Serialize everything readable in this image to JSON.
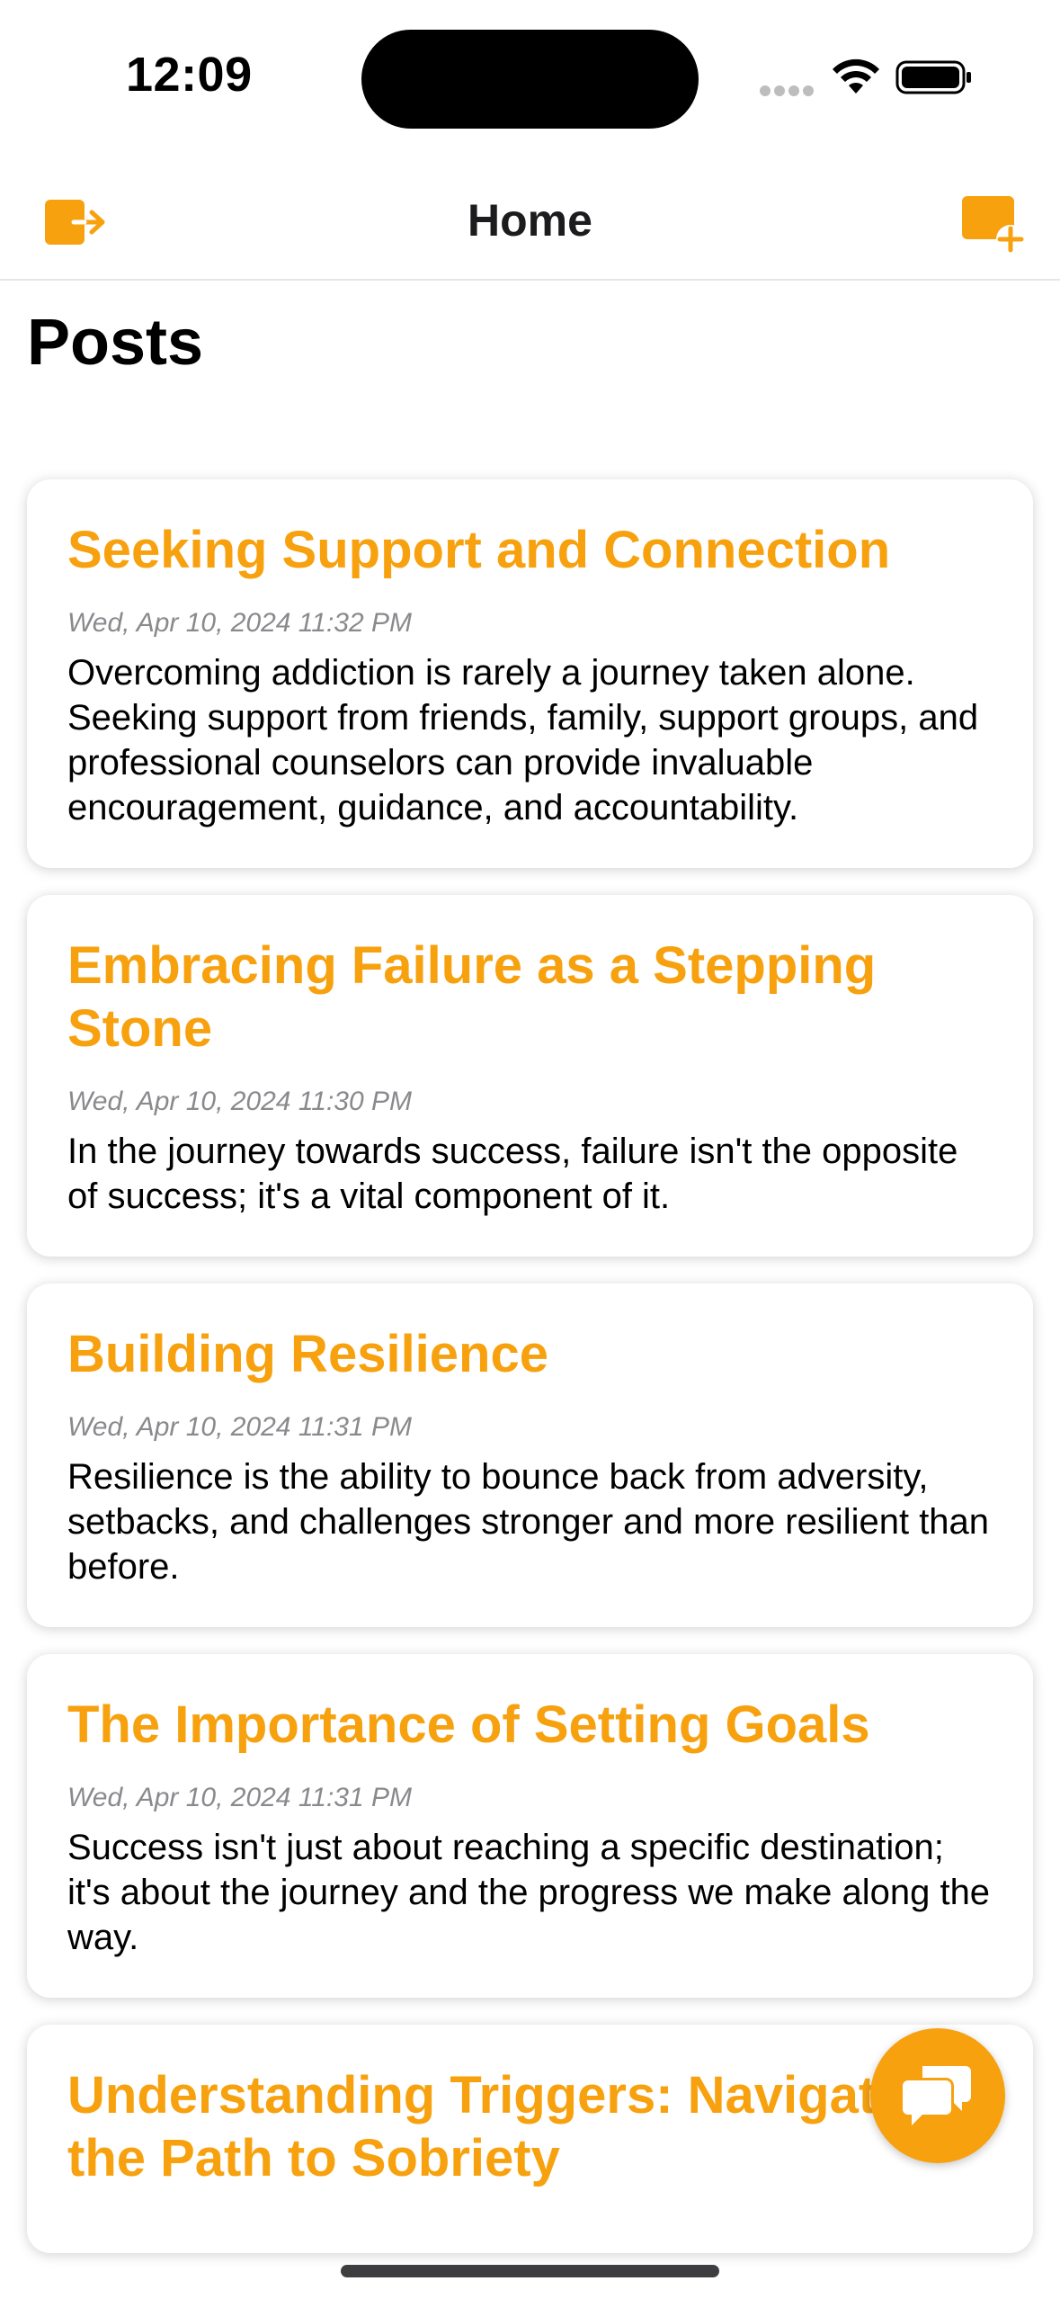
{
  "status_bar": {
    "time": "12:09"
  },
  "nav": {
    "title": "Home",
    "left_icon": "logout-icon",
    "right_icon": "new-post-icon"
  },
  "section": {
    "title": "Posts"
  },
  "posts": [
    {
      "title": "Seeking Support and Connection",
      "date": "Wed, Apr 10, 2024 11:32 PM",
      "body": "Overcoming addiction is rarely a journey taken alone. Seeking support from friends, family, support groups, and professional counselors can provide invaluable encouragement, guidance, and accountability."
    },
    {
      "title": "Embracing Failure as a Stepping Stone",
      "date": "Wed, Apr 10, 2024 11:30 PM",
      "body": "In the journey towards success, failure isn't the opposite of success; it's a vital component of it."
    },
    {
      "title": "Building Resilience",
      "date": "Wed, Apr 10, 2024 11:31 PM",
      "body": "Resilience is the ability to bounce back from adversity, setbacks, and challenges stronger and more resilient than before."
    },
    {
      "title": "The Importance of Setting Goals",
      "date": "Wed, Apr 10, 2024 11:31 PM",
      "body": "Success isn't just about reaching a specific destination; it's about the journey and the progress we make along the way."
    },
    {
      "title": "Understanding Triggers: Navigating the Path to Sobriety",
      "date": "",
      "body": ""
    }
  ],
  "fab": {
    "icon": "chat-bubbles-icon"
  },
  "colors": {
    "accent": "#f7a10f",
    "date_gray": "#8a8a8e"
  }
}
